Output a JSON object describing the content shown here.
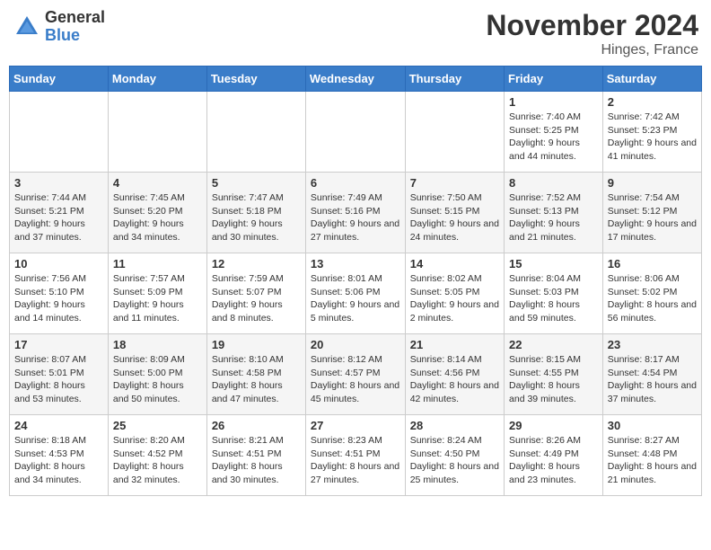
{
  "logo": {
    "general": "General",
    "blue": "Blue"
  },
  "title": "November 2024",
  "location": "Hinges, France",
  "days_header": [
    "Sunday",
    "Monday",
    "Tuesday",
    "Wednesday",
    "Thursday",
    "Friday",
    "Saturday"
  ],
  "weeks": [
    [
      {
        "day": "",
        "info": ""
      },
      {
        "day": "",
        "info": ""
      },
      {
        "day": "",
        "info": ""
      },
      {
        "day": "",
        "info": ""
      },
      {
        "day": "",
        "info": ""
      },
      {
        "day": "1",
        "info": "Sunrise: 7:40 AM\nSunset: 5:25 PM\nDaylight: 9 hours and 44 minutes."
      },
      {
        "day": "2",
        "info": "Sunrise: 7:42 AM\nSunset: 5:23 PM\nDaylight: 9 hours and 41 minutes."
      }
    ],
    [
      {
        "day": "3",
        "info": "Sunrise: 7:44 AM\nSunset: 5:21 PM\nDaylight: 9 hours and 37 minutes."
      },
      {
        "day": "4",
        "info": "Sunrise: 7:45 AM\nSunset: 5:20 PM\nDaylight: 9 hours and 34 minutes."
      },
      {
        "day": "5",
        "info": "Sunrise: 7:47 AM\nSunset: 5:18 PM\nDaylight: 9 hours and 30 minutes."
      },
      {
        "day": "6",
        "info": "Sunrise: 7:49 AM\nSunset: 5:16 PM\nDaylight: 9 hours and 27 minutes."
      },
      {
        "day": "7",
        "info": "Sunrise: 7:50 AM\nSunset: 5:15 PM\nDaylight: 9 hours and 24 minutes."
      },
      {
        "day": "8",
        "info": "Sunrise: 7:52 AM\nSunset: 5:13 PM\nDaylight: 9 hours and 21 minutes."
      },
      {
        "day": "9",
        "info": "Sunrise: 7:54 AM\nSunset: 5:12 PM\nDaylight: 9 hours and 17 minutes."
      }
    ],
    [
      {
        "day": "10",
        "info": "Sunrise: 7:56 AM\nSunset: 5:10 PM\nDaylight: 9 hours and 14 minutes."
      },
      {
        "day": "11",
        "info": "Sunrise: 7:57 AM\nSunset: 5:09 PM\nDaylight: 9 hours and 11 minutes."
      },
      {
        "day": "12",
        "info": "Sunrise: 7:59 AM\nSunset: 5:07 PM\nDaylight: 9 hours and 8 minutes."
      },
      {
        "day": "13",
        "info": "Sunrise: 8:01 AM\nSunset: 5:06 PM\nDaylight: 9 hours and 5 minutes."
      },
      {
        "day": "14",
        "info": "Sunrise: 8:02 AM\nSunset: 5:05 PM\nDaylight: 9 hours and 2 minutes."
      },
      {
        "day": "15",
        "info": "Sunrise: 8:04 AM\nSunset: 5:03 PM\nDaylight: 8 hours and 59 minutes."
      },
      {
        "day": "16",
        "info": "Sunrise: 8:06 AM\nSunset: 5:02 PM\nDaylight: 8 hours and 56 minutes."
      }
    ],
    [
      {
        "day": "17",
        "info": "Sunrise: 8:07 AM\nSunset: 5:01 PM\nDaylight: 8 hours and 53 minutes."
      },
      {
        "day": "18",
        "info": "Sunrise: 8:09 AM\nSunset: 5:00 PM\nDaylight: 8 hours and 50 minutes."
      },
      {
        "day": "19",
        "info": "Sunrise: 8:10 AM\nSunset: 4:58 PM\nDaylight: 8 hours and 47 minutes."
      },
      {
        "day": "20",
        "info": "Sunrise: 8:12 AM\nSunset: 4:57 PM\nDaylight: 8 hours and 45 minutes."
      },
      {
        "day": "21",
        "info": "Sunrise: 8:14 AM\nSunset: 4:56 PM\nDaylight: 8 hours and 42 minutes."
      },
      {
        "day": "22",
        "info": "Sunrise: 8:15 AM\nSunset: 4:55 PM\nDaylight: 8 hours and 39 minutes."
      },
      {
        "day": "23",
        "info": "Sunrise: 8:17 AM\nSunset: 4:54 PM\nDaylight: 8 hours and 37 minutes."
      }
    ],
    [
      {
        "day": "24",
        "info": "Sunrise: 8:18 AM\nSunset: 4:53 PM\nDaylight: 8 hours and 34 minutes."
      },
      {
        "day": "25",
        "info": "Sunrise: 8:20 AM\nSunset: 4:52 PM\nDaylight: 8 hours and 32 minutes."
      },
      {
        "day": "26",
        "info": "Sunrise: 8:21 AM\nSunset: 4:51 PM\nDaylight: 8 hours and 30 minutes."
      },
      {
        "day": "27",
        "info": "Sunrise: 8:23 AM\nSunset: 4:51 PM\nDaylight: 8 hours and 27 minutes."
      },
      {
        "day": "28",
        "info": "Sunrise: 8:24 AM\nSunset: 4:50 PM\nDaylight: 8 hours and 25 minutes."
      },
      {
        "day": "29",
        "info": "Sunrise: 8:26 AM\nSunset: 4:49 PM\nDaylight: 8 hours and 23 minutes."
      },
      {
        "day": "30",
        "info": "Sunrise: 8:27 AM\nSunset: 4:48 PM\nDaylight: 8 hours and 21 minutes."
      }
    ]
  ]
}
